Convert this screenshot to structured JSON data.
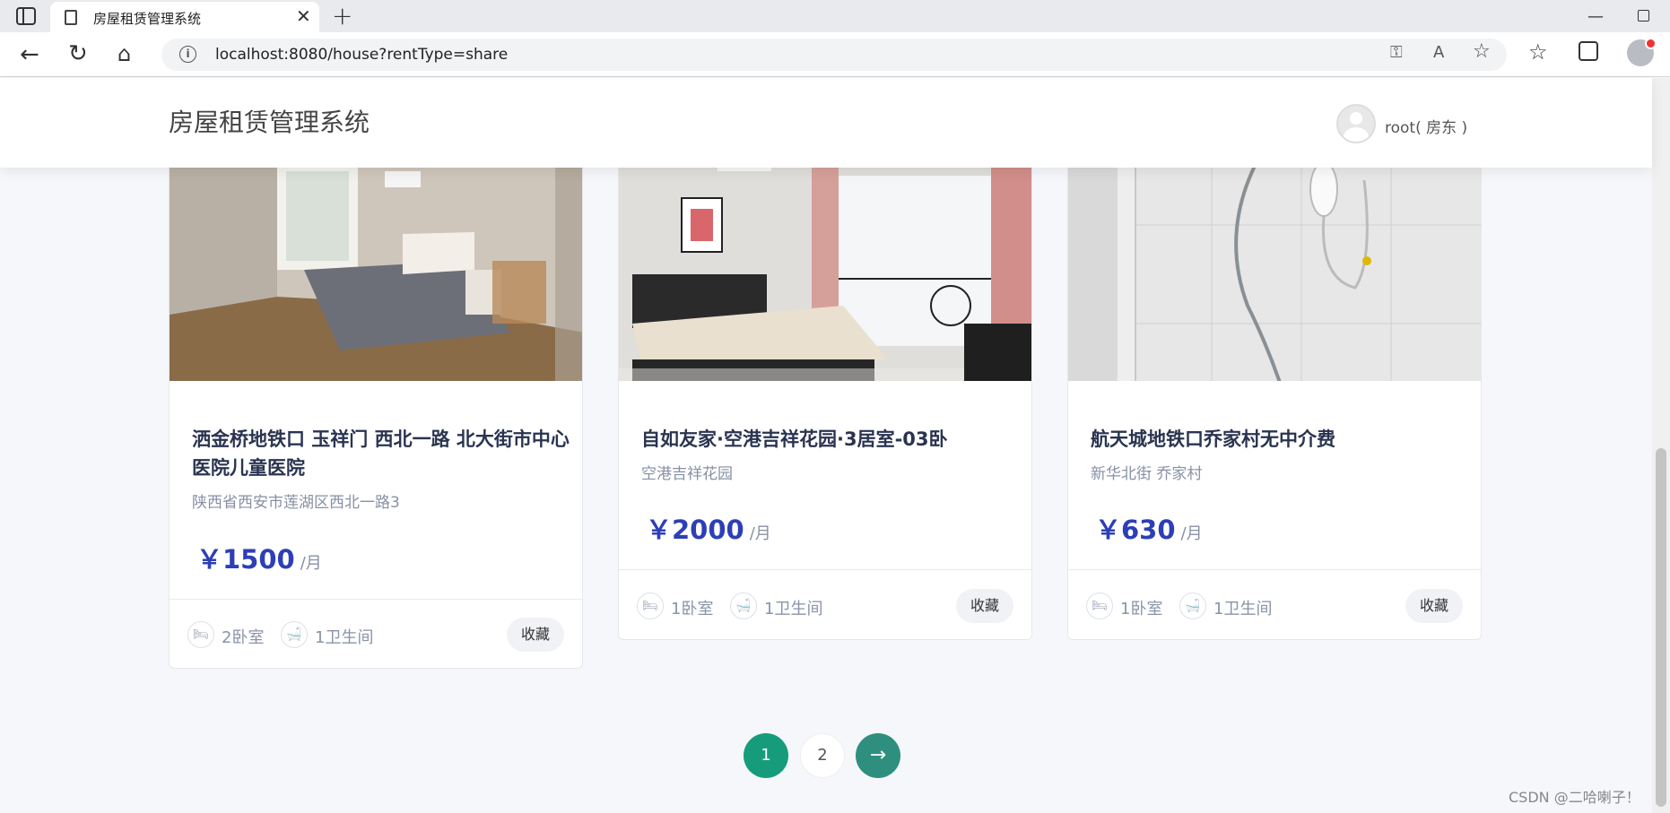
{
  "browser": {
    "tab_title": "房屋租赁管理系统",
    "url": "localhost:8080/house?rentType=share"
  },
  "header": {
    "site_title": "房屋租赁管理系统",
    "user_label": "root( 房东 )"
  },
  "cards": [
    {
      "title": "洒金桥地铁口 玉祥门 西北一路 北大街市中心医院儿童医院",
      "address": "陕西省西安市莲湖区西北一路3",
      "price": "￥1500",
      "unit": "/月",
      "bedrooms": "2卧室",
      "bathrooms": "1卫生间",
      "fav_label": "收藏"
    },
    {
      "title": "自如友家·空港吉祥花园·3居室-03卧",
      "address": "空港吉祥花园",
      "price": "￥2000",
      "unit": "/月",
      "bedrooms": "1卧室",
      "bathrooms": "1卫生间",
      "fav_label": "收藏"
    },
    {
      "title": "航天城地铁口乔家村无中介费",
      "address": "新华北街 乔家村",
      "price": "￥630",
      "unit": "/月",
      "bedrooms": "1卧室",
      "bathrooms": "1卫生间",
      "fav_label": "收藏"
    }
  ],
  "pagination": {
    "page1": "1",
    "page2": "2",
    "next_icon": "arrow-right-icon"
  },
  "watermark": "CSDN @二哈喇子！",
  "colors": {
    "price": "#2d3fb7",
    "pager_active": "#169c7b",
    "pager_next": "#2f8f7f"
  }
}
